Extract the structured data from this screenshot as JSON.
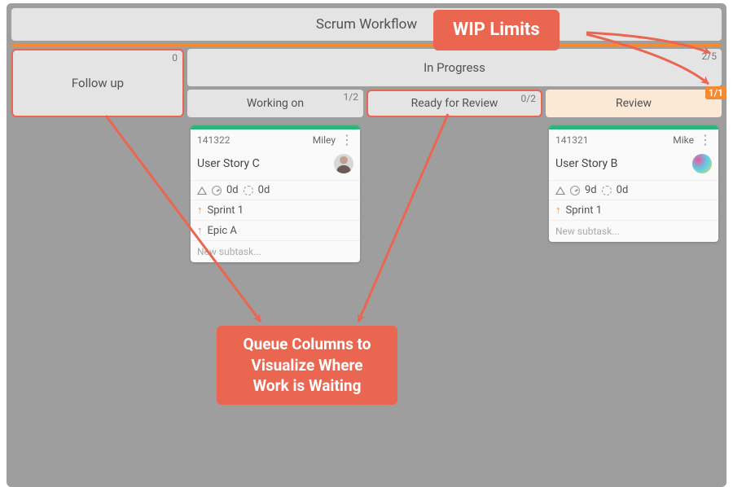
{
  "board": {
    "title": "Scrum Workflow",
    "columns": {
      "followup": {
        "label": "Follow up",
        "limit": "0"
      },
      "inprogress": {
        "label": "In Progress",
        "limit": "2/5",
        "sub": {
          "workingon": {
            "label": "Working on",
            "limit": "1/2"
          },
          "readyreview": {
            "label": "Ready for Review",
            "limit": "0/2"
          },
          "review": {
            "label": "Review",
            "limit": "1/1"
          }
        }
      }
    }
  },
  "cards": {
    "c1": {
      "id": "141322",
      "assignee": "Miley",
      "title": "User Story C",
      "time1": "0d",
      "time2": "0d",
      "links": [
        "Sprint 1",
        "Epic A"
      ],
      "subtask_placeholder": "New subtask..."
    },
    "c2": {
      "id": "141321",
      "assignee": "Mike",
      "title": "User Story B",
      "time1": "9d",
      "time2": "0d",
      "links": [
        "Sprint 1"
      ],
      "subtask_placeholder": "New subtask..."
    }
  },
  "annotations": {
    "wip": "WIP Limits",
    "queue": "Queue Columns to Visualize Where Work is Waiting"
  }
}
